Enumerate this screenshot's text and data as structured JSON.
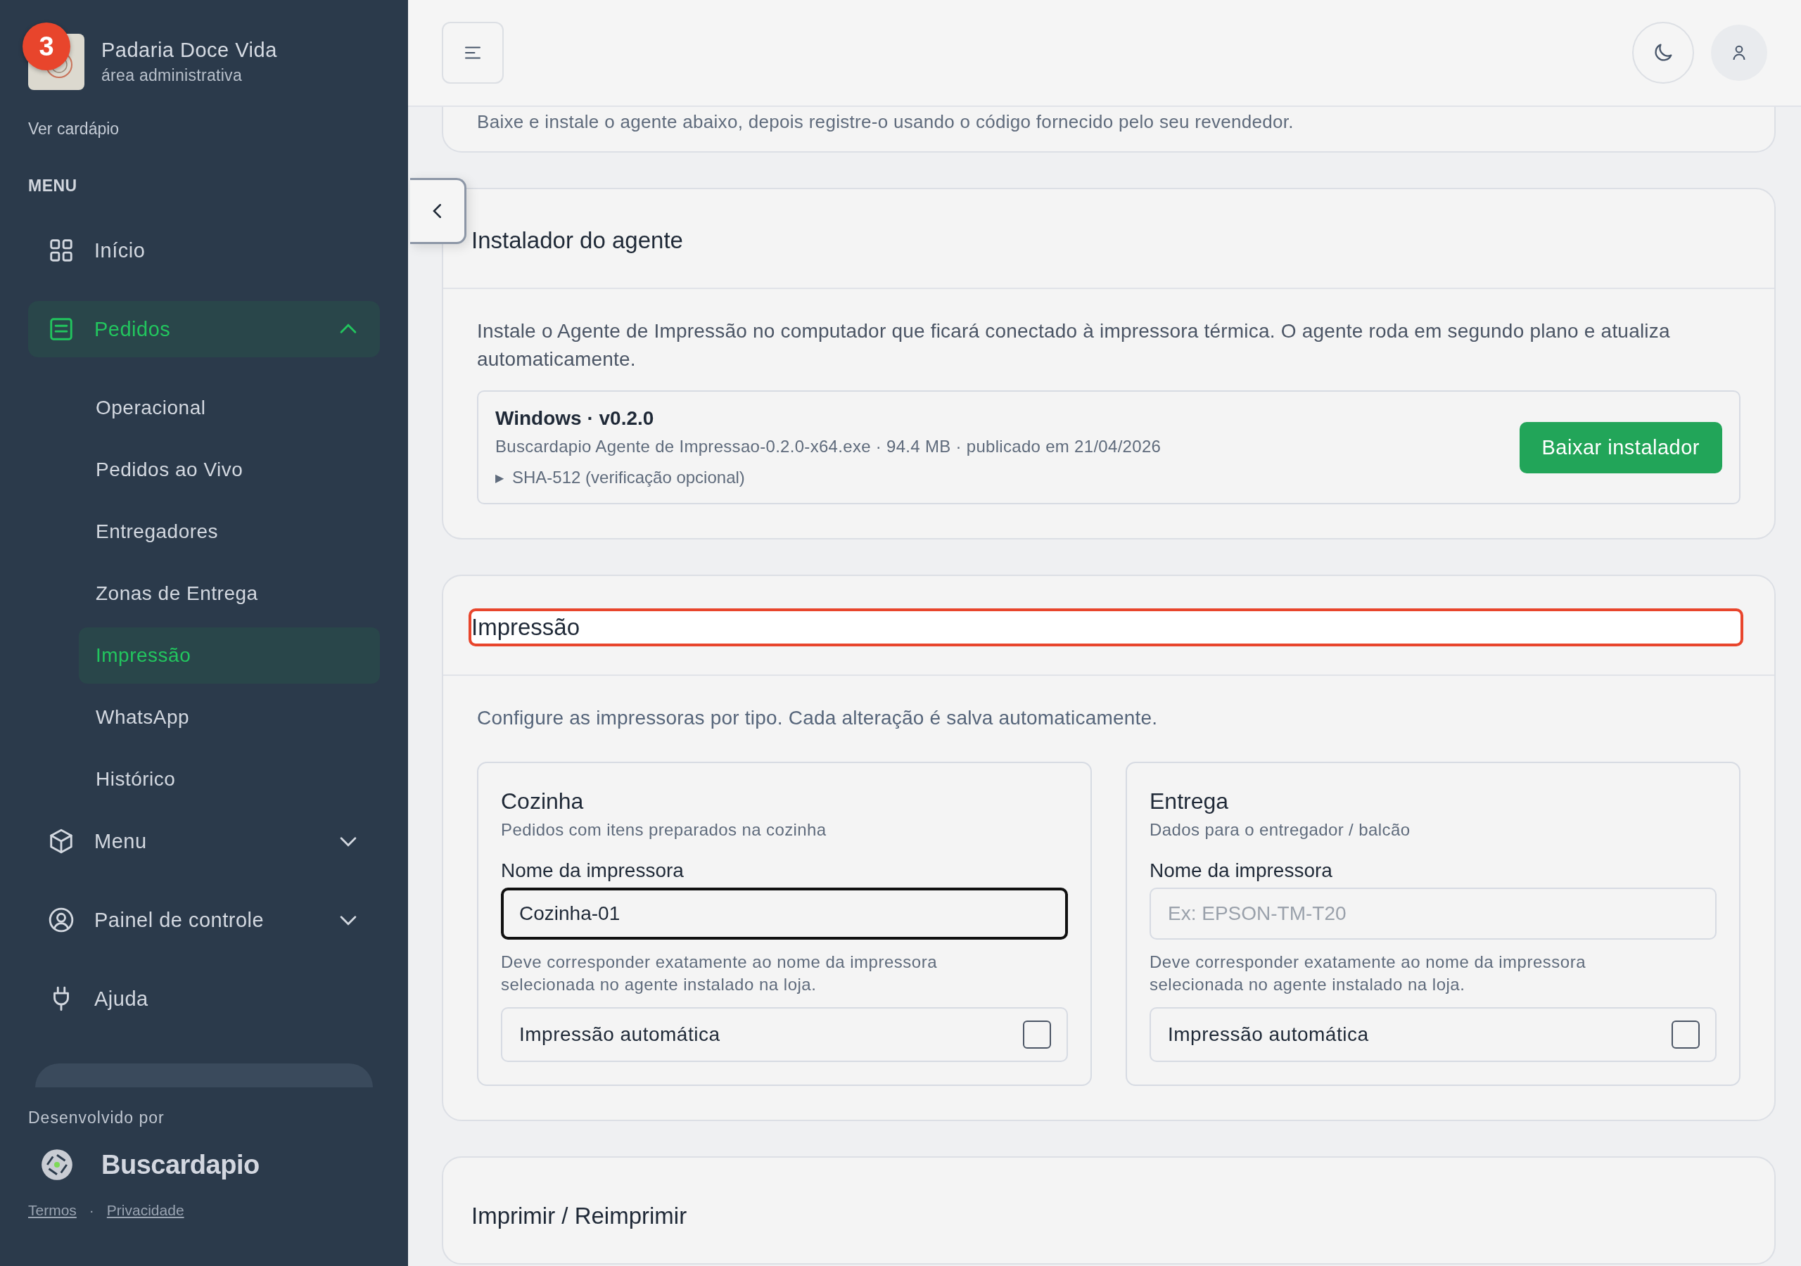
{
  "sidebar": {
    "badge": "3",
    "brand_name": "Padaria Doce Vida",
    "brand_subtitle": "área administrativa",
    "menu_link": "Ver cardápio",
    "section_label": "MENU",
    "items": [
      {
        "label": "Início",
        "selected": false
      },
      {
        "label": "Pedidos",
        "selected": true,
        "expanded": true,
        "children": [
          {
            "label": "Operacional",
            "selected": false
          },
          {
            "label": "Pedidos ao Vivo",
            "selected": false
          },
          {
            "label": "Entregadores",
            "selected": false
          },
          {
            "label": "Zonas de Entrega",
            "selected": false
          },
          {
            "label": "Impressão",
            "selected": true
          },
          {
            "label": "WhatsApp",
            "selected": false
          },
          {
            "label": "Histórico",
            "selected": false
          }
        ]
      },
      {
        "label": "Menu",
        "selected": false,
        "expanded": false
      },
      {
        "label": "Painel de controle",
        "selected": false,
        "expanded": false
      },
      {
        "label": "Ajuda",
        "selected": false
      }
    ],
    "footer": {
      "credit": "Desenvolvido por",
      "brand": "Buscardapio",
      "links": [
        "Termos",
        "Privacidade"
      ],
      "separator": "·"
    }
  },
  "intro_card": {
    "text": "Baixe e instale o agente abaixo, depois registre-o usando o código fornecido pelo seu revendedor."
  },
  "installer": {
    "title": "Instalador do agente",
    "description": "Instale o Agente de Impressão no computador que ficará conectado à impressora térmica. O agente roda em segundo plano e atualiza automaticamente.",
    "release": {
      "title": "Windows · v0.2.0",
      "details": "Buscardapio Agente de Impressao-0.2.0-x64.exe · 94.4 MB · publicado em 21/04/2026",
      "checksum_marker": "▶",
      "checksum_label": "SHA-512 (verificação opcional)",
      "button": "Baixar instalador"
    }
  },
  "printing": {
    "title": "Impressão",
    "highlighted": true,
    "description": "Configure as impressoras por tipo. Cada alteração é salva automaticamente.",
    "printers": [
      {
        "name": "Cozinha",
        "subtitle": "Pedidos com itens preparados na cozinha",
        "field_label": "Nome da impressora",
        "value": "Cozinha-01",
        "focused": true,
        "hint": "Deve corresponder exatamente ao nome da impressora selecionada no agente instalado na loja.",
        "toggle_label": "Impressão automática",
        "checked": false
      },
      {
        "name": "Entrega",
        "subtitle": "Dados para o entregador / balcão",
        "field_label": "Nome da impressora",
        "placeholder": "Ex: EPSON-TM-T20",
        "focused": false,
        "hint": "Deve corresponder exatamente ao nome da impressora selecionada no agente instalado na loja.",
        "toggle_label": "Impressão automática",
        "checked": false
      }
    ]
  },
  "reprint": {
    "title": "Imprimir / Reimprimir"
  }
}
